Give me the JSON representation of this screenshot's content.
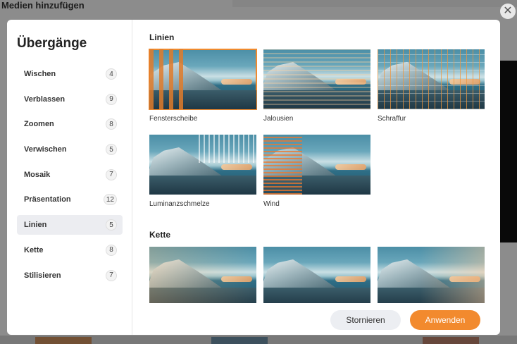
{
  "background": {
    "title": "Medien hinzufügen"
  },
  "dialog": {
    "title": "Übergänge",
    "close_icon": "close-icon"
  },
  "categories": [
    {
      "label": "Wischen",
      "count": "4"
    },
    {
      "label": "Verblassen",
      "count": "9"
    },
    {
      "label": "Zoomen",
      "count": "8"
    },
    {
      "label": "Verwischen",
      "count": "5"
    },
    {
      "label": "Mosaik",
      "count": "7"
    },
    {
      "label": "Präsentation",
      "count": "12"
    },
    {
      "label": "Linien",
      "count": "5",
      "active": true
    },
    {
      "label": "Kette",
      "count": "8"
    },
    {
      "label": "Stilisieren",
      "count": "7"
    }
  ],
  "sections": {
    "linien": {
      "title": "Linien",
      "items": [
        {
          "label": "Fensterscheibe",
          "selected": true
        },
        {
          "label": "Jalousien"
        },
        {
          "label": "Schraffur"
        },
        {
          "label": "Luminanzschmelze"
        },
        {
          "label": "Wind"
        }
      ]
    },
    "kette": {
      "title": "Kette"
    }
  },
  "buttons": {
    "cancel": "Stornieren",
    "apply": "Anwenden"
  },
  "colors": {
    "accent": "#f28a2e",
    "active_item_bg": "#ecedf1"
  }
}
